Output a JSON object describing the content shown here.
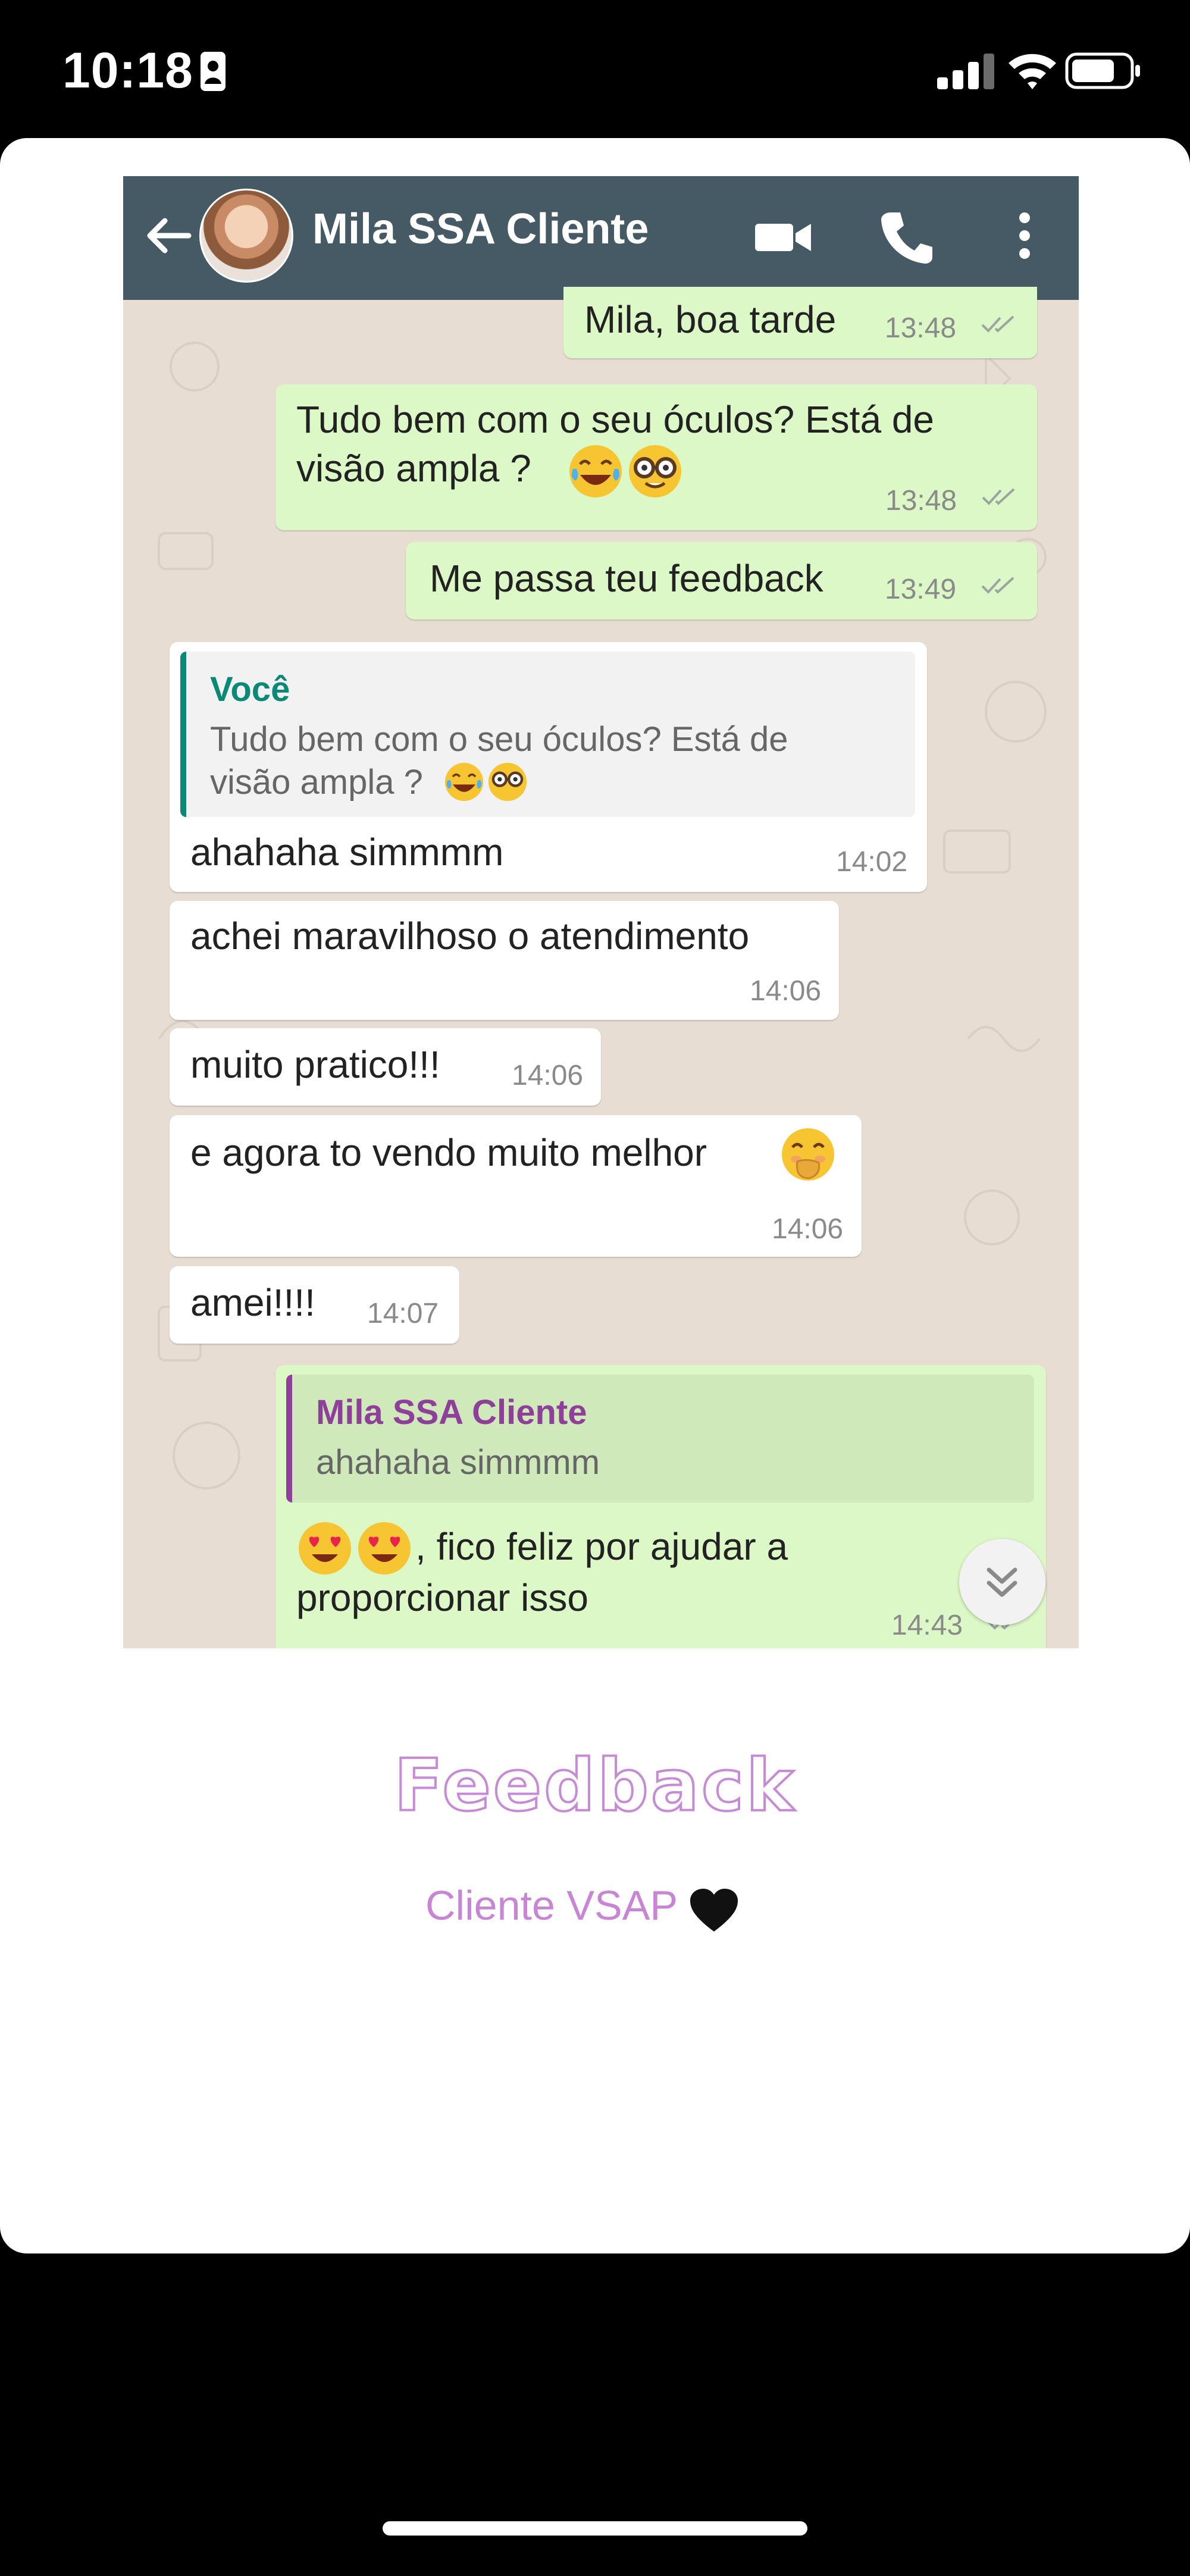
{
  "status_bar": {
    "time": "10:18",
    "icons": [
      "id-card-icon",
      "cellular-signal-icon",
      "wifi-icon",
      "battery-icon"
    ]
  },
  "chat": {
    "header": {
      "contact_name": "Mila SSA Cliente",
      "icons": [
        "back-arrow-icon",
        "avatar",
        "video-call-icon",
        "phone-call-icon",
        "more-options-icon"
      ],
      "background_color": "#455a64"
    },
    "messages": [
      {
        "direction": "outgoing",
        "text": "Mila, boa tarde",
        "time": "13:48",
        "status": "read-double-tick"
      },
      {
        "direction": "outgoing",
        "line1": "Tudo bem com o seu óculos? Está de",
        "line2": "visão ampla ?",
        "emojis": [
          "laughing-tears-emoji",
          "nerd-glasses-emoji"
        ],
        "time": "13:48",
        "status": "read-double-tick"
      },
      {
        "direction": "outgoing",
        "text": "Me passa teu feedback",
        "time": "13:49",
        "status": "read-double-tick"
      },
      {
        "direction": "incoming",
        "quote_author": "Você",
        "quote_line1": "Tudo bem com o seu óculos? Está de",
        "quote_line2": "visão ampla ?",
        "text": "ahahaha simmmm",
        "time": "14:02"
      },
      {
        "direction": "incoming",
        "text": "achei maravilhoso o atendimento",
        "time": "14:06"
      },
      {
        "direction": "incoming",
        "text": "muito pratico!!!",
        "time": "14:06"
      },
      {
        "direction": "incoming",
        "text": "e agora to vendo muito melhor",
        "emojis": [
          "hand-over-mouth-emoji"
        ],
        "time": "14:06"
      },
      {
        "direction": "incoming",
        "text": "amei!!!!",
        "time": "14:07"
      },
      {
        "direction": "outgoing",
        "quote_author": "Mila SSA Cliente",
        "quote_text": "ahahaha simmmm",
        "emojis": [
          "heart-eyes-emoji",
          "heart-eyes-emoji"
        ],
        "line1": ", fico feliz por ajudar a",
        "line2": "proporcionar isso",
        "time": "14:43",
        "status": "read-double-tick"
      }
    ],
    "colors": {
      "outgoing_bubble": "#dcf8c6",
      "incoming_bubble": "#ffffff",
      "chat_background": "#e7ddd3",
      "quote_you_accent": "#0a8a76",
      "quote_contact_accent": "#8e3f9a"
    }
  },
  "caption": {
    "title": "Feedback",
    "subtitle": "Cliente VSAP",
    "subtitle_icon": "black-heart-icon",
    "accent_color": "#c785d4"
  }
}
